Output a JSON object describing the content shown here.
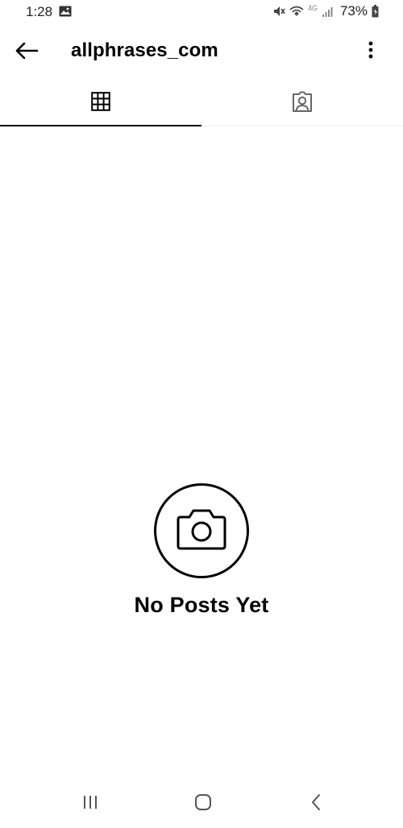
{
  "status_bar": {
    "time": "1:28",
    "network": "4G",
    "battery": "73%"
  },
  "app_bar": {
    "title": "allphrases_com",
    "back_icon": "arrow-left-icon",
    "menu_icon": "more-vertical-icon"
  },
  "tabs": [
    {
      "id": "grid",
      "icon": "grid-icon",
      "active": true
    },
    {
      "id": "tagged",
      "icon": "tagged-person-icon",
      "active": false
    }
  ],
  "empty_state": {
    "icon": "camera-icon",
    "title": "No Posts Yet"
  },
  "nav_bar": {
    "items": [
      "recent-apps-icon",
      "home-icon",
      "back-icon"
    ]
  },
  "colors": {
    "background": "#ffffff",
    "text": "#000000",
    "tab_indicator": "#000000",
    "divider": "#ededed"
  }
}
